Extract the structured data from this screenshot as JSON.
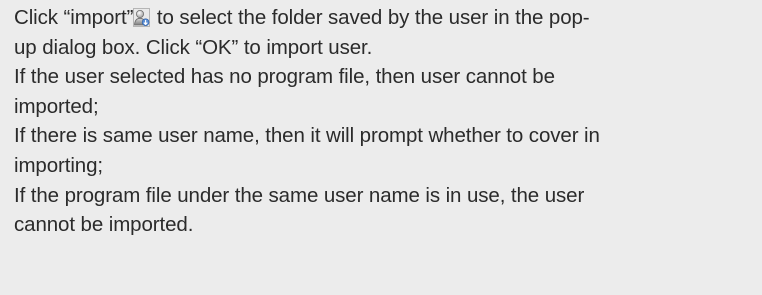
{
  "paragraphs": {
    "import_step": {
      "line1_prefix": " Click “import”",
      "icon": "import-user-icon",
      "line1_suffix": " to select the folder saved by the user in the pop-",
      "line2": "up dialog box. Click “OK” to import user."
    },
    "no_program": {
      "line1": "If the user selected has no program file, then user cannot be",
      "line2": "imported;"
    },
    "same_name": {
      "line1": "If there is same user name, then it will prompt whether to cover in",
      "line2": "importing;"
    },
    "in_use": {
      "line1": "If the program file under the same user name is in use, the user",
      "line2": "cannot be imported."
    }
  }
}
